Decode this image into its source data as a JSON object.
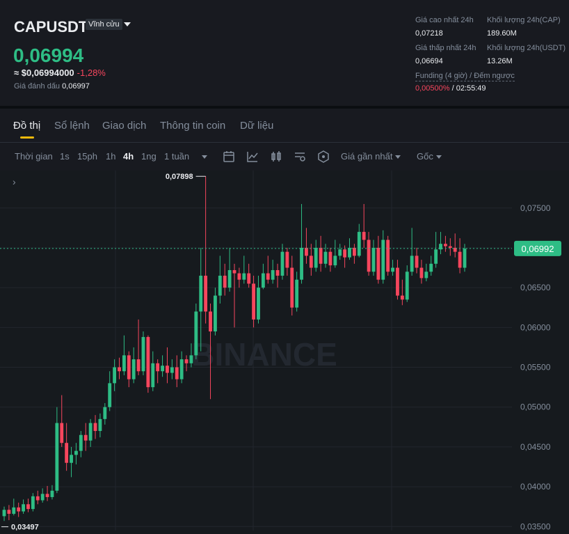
{
  "header": {
    "symbol": "CAPUSDT",
    "contract_type": "Vĩnh cửu",
    "last_price": "0,06994",
    "approx_usd": "≈ $0,06994000",
    "change_pct": "-1,28%",
    "mark_label": "Giá đánh dấu",
    "mark_value": "0,06997",
    "stats": [
      {
        "label": "Giá cao nhất 24h",
        "value": "0,07218"
      },
      {
        "label": "Khối lượng 24h(CAP)",
        "value": "189.60M"
      },
      {
        "label": "Giá thấp nhất 24h",
        "value": "0,06694"
      },
      {
        "label": "Khối lượng 24h(USDT)",
        "value": "13.26M"
      }
    ],
    "funding_label": "Funding (4 giờ) / Đếm ngược",
    "funding_rate": "0,00500%",
    "countdown": "/ 02:55:49"
  },
  "tabs": [
    "Đồ thị",
    "Sổ lệnh",
    "Giao dịch",
    "Thông tin coin",
    "Dữ liệu"
  ],
  "toolbar": {
    "time_label": "Thời gian",
    "intervals": [
      "1s",
      "15ph",
      "1h",
      "4h",
      "1ng",
      "1 tuần"
    ],
    "active_interval": "4h",
    "price_type": "Giá gần nhất",
    "origin": "Gốc",
    "icons": [
      "calendar-icon",
      "indicator-icon",
      "candle-type-icon",
      "settings-icon",
      "depth-icon"
    ]
  },
  "colors": {
    "up": "#2ebd85",
    "down": "#f6465d",
    "accent": "#f0b90b"
  },
  "chart_data": {
    "type": "candlestick",
    "y_axis_ticks": [
      "0,07500",
      "0,07000",
      "0,06500",
      "0,06000",
      "0,05500",
      "0,05000",
      "0,04500",
      "0,04000",
      "0,03500"
    ],
    "ylim": [
      0.0345,
      0.0797
    ],
    "current_price_label": "0,06992",
    "current_price": 0.06992,
    "high_marker_label": "0,07898",
    "high_marker_value": 0.07898,
    "low_marker_label": "0,03497",
    "low_marker_value": 0.03497,
    "watermark": "BINANCE",
    "candles": [
      [
        0.0363,
        0.0371,
        0.0375,
        0.0357
      ],
      [
        0.0371,
        0.0366,
        0.0377,
        0.0358
      ],
      [
        0.0366,
        0.0374,
        0.0385,
        0.0364
      ],
      [
        0.0374,
        0.0369,
        0.038,
        0.0362
      ],
      [
        0.0369,
        0.0378,
        0.0384,
        0.0366
      ],
      [
        0.0378,
        0.0372,
        0.0385,
        0.0368
      ],
      [
        0.0372,
        0.0388,
        0.0392,
        0.0369
      ],
      [
        0.0388,
        0.0383,
        0.0395,
        0.0378
      ],
      [
        0.0383,
        0.0391,
        0.0398,
        0.038
      ],
      [
        0.0391,
        0.0387,
        0.0401,
        0.0382
      ],
      [
        0.0387,
        0.0395,
        0.0402,
        0.0384
      ],
      [
        0.0395,
        0.048,
        0.05,
        0.0392
      ],
      [
        0.048,
        0.0455,
        0.0515,
        0.045
      ],
      [
        0.0455,
        0.043,
        0.048,
        0.042
      ],
      [
        0.043,
        0.044,
        0.045,
        0.0412
      ],
      [
        0.044,
        0.0445,
        0.0455,
        0.0428
      ],
      [
        0.0445,
        0.0465,
        0.047,
        0.0437
      ],
      [
        0.0465,
        0.0458,
        0.048,
        0.0445
      ],
      [
        0.0458,
        0.048,
        0.0485,
        0.045
      ],
      [
        0.048,
        0.047,
        0.049,
        0.046
      ],
      [
        0.047,
        0.0485,
        0.0492,
        0.0462
      ],
      [
        0.0485,
        0.05,
        0.0505,
        0.0478
      ],
      [
        0.05,
        0.053,
        0.0545,
        0.0495
      ],
      [
        0.053,
        0.055,
        0.056,
        0.052
      ],
      [
        0.055,
        0.0545,
        0.0562,
        0.0535
      ],
      [
        0.0545,
        0.0565,
        0.059,
        0.054
      ],
      [
        0.0565,
        0.0535,
        0.057,
        0.0525
      ],
      [
        0.0535,
        0.056,
        0.0575,
        0.053
      ],
      [
        0.056,
        0.0545,
        0.061,
        0.054
      ],
      [
        0.0545,
        0.0588,
        0.0595,
        0.054
      ],
      [
        0.0588,
        0.0525,
        0.059,
        0.0518
      ],
      [
        0.0525,
        0.0555,
        0.057,
        0.052
      ],
      [
        0.0555,
        0.0545,
        0.056,
        0.053
      ],
      [
        0.0545,
        0.0552,
        0.0565,
        0.0538
      ],
      [
        0.0552,
        0.0543,
        0.0575,
        0.053
      ],
      [
        0.0543,
        0.055,
        0.056,
        0.0535
      ],
      [
        0.055,
        0.0535,
        0.0565,
        0.0525
      ],
      [
        0.0535,
        0.056,
        0.057,
        0.053
      ],
      [
        0.056,
        0.0555,
        0.0565,
        0.0545
      ],
      [
        0.0555,
        0.0565,
        0.058,
        0.055
      ],
      [
        0.0565,
        0.062,
        0.063,
        0.056
      ],
      [
        0.062,
        0.0665,
        0.07,
        0.057
      ],
      [
        0.0665,
        0.062,
        0.079,
        0.0605
      ],
      [
        0.062,
        0.0595,
        0.063,
        0.051
      ],
      [
        0.0595,
        0.064,
        0.065,
        0.059
      ],
      [
        0.064,
        0.0665,
        0.069,
        0.063
      ],
      [
        0.0665,
        0.065,
        0.068,
        0.064
      ],
      [
        0.065,
        0.0672,
        0.07,
        0.0645
      ],
      [
        0.0672,
        0.0668,
        0.068,
        0.06
      ],
      [
        0.0668,
        0.066,
        0.0675,
        0.065
      ],
      [
        0.066,
        0.0668,
        0.069,
        0.0655
      ],
      [
        0.0668,
        0.0655,
        0.068,
        0.065
      ],
      [
        0.0655,
        0.061,
        0.0665,
        0.06
      ],
      [
        0.061,
        0.065,
        0.0665,
        0.0605
      ],
      [
        0.065,
        0.0668,
        0.068,
        0.0648
      ],
      [
        0.0668,
        0.066,
        0.069,
        0.0655
      ],
      [
        0.066,
        0.0672,
        0.0685,
        0.0655
      ],
      [
        0.0672,
        0.0665,
        0.068,
        0.065
      ],
      [
        0.0665,
        0.0695,
        0.0705,
        0.066
      ],
      [
        0.0695,
        0.0675,
        0.07,
        0.0665
      ],
      [
        0.0675,
        0.0625,
        0.069,
        0.0615
      ],
      [
        0.0625,
        0.066,
        0.067,
        0.062
      ],
      [
        0.066,
        0.07,
        0.0755,
        0.0655
      ],
      [
        0.07,
        0.069,
        0.0725,
        0.068
      ],
      [
        0.069,
        0.0675,
        0.0705,
        0.0665
      ],
      [
        0.0675,
        0.07,
        0.071,
        0.067
      ],
      [
        0.07,
        0.068,
        0.0715,
        0.067
      ],
      [
        0.068,
        0.0695,
        0.0705,
        0.0675
      ],
      [
        0.0695,
        0.0678,
        0.07,
        0.067
      ],
      [
        0.0678,
        0.069,
        0.071,
        0.0675
      ],
      [
        0.069,
        0.0698,
        0.0705,
        0.0685
      ],
      [
        0.0698,
        0.0688,
        0.0703,
        0.0675
      ],
      [
        0.0688,
        0.07,
        0.0712,
        0.0685
      ],
      [
        0.07,
        0.069,
        0.0705,
        0.068
      ],
      [
        0.069,
        0.072,
        0.073,
        0.0688
      ],
      [
        0.072,
        0.071,
        0.0755,
        0.07
      ],
      [
        0.071,
        0.067,
        0.072,
        0.0665
      ],
      [
        0.067,
        0.07,
        0.071,
        0.0665
      ],
      [
        0.07,
        0.066,
        0.0715,
        0.0655
      ],
      [
        0.066,
        0.071,
        0.0722,
        0.0655
      ],
      [
        0.071,
        0.067,
        0.0715,
        0.0665
      ],
      [
        0.067,
        0.0675,
        0.0685,
        0.0665
      ],
      [
        0.0675,
        0.064,
        0.0685,
        0.0635
      ],
      [
        0.064,
        0.0635,
        0.066,
        0.0628
      ],
      [
        0.0635,
        0.067,
        0.0678,
        0.0632
      ],
      [
        0.067,
        0.069,
        0.0725,
        0.0665
      ],
      [
        0.069,
        0.0675,
        0.07,
        0.0668
      ],
      [
        0.0675,
        0.0662,
        0.0685,
        0.0655
      ],
      [
        0.0662,
        0.067,
        0.068,
        0.0658
      ],
      [
        0.067,
        0.068,
        0.069,
        0.0665
      ],
      [
        0.068,
        0.0698,
        0.072,
        0.0675
      ],
      [
        0.0698,
        0.0705,
        0.072,
        0.0692
      ],
      [
        0.0705,
        0.0702,
        0.0715,
        0.0695
      ],
      [
        0.0702,
        0.07,
        0.0712,
        0.069
      ],
      [
        0.07,
        0.0695,
        0.0718,
        0.0688
      ],
      [
        0.0695,
        0.0675,
        0.0712,
        0.0668
      ],
      [
        0.0675,
        0.0699,
        0.0705,
        0.067
      ]
    ]
  }
}
